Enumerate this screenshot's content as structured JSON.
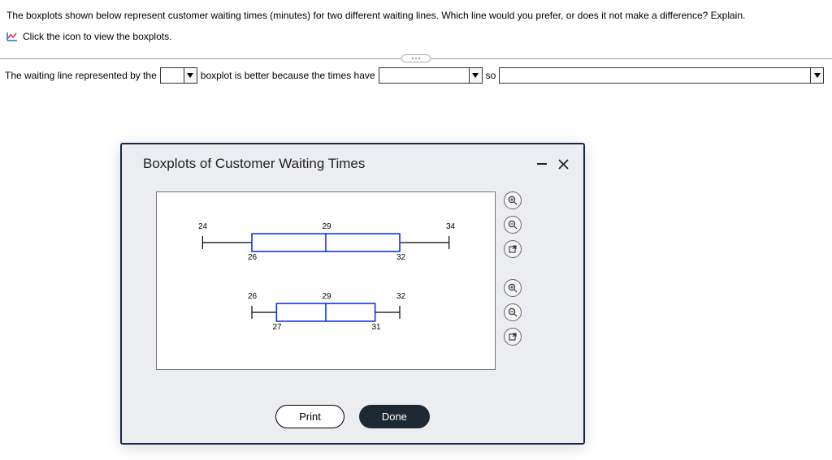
{
  "question": {
    "text": "The boxplots shown below represent customer waiting times (minutes) for two different waiting lines. Which line would you prefer, or does it not make a difference? Explain.",
    "view_link": "Click the icon to view the boxplots."
  },
  "sentence": {
    "part1": "The waiting line represented by the",
    "part2": "boxplot is better because the times have",
    "part3": "so"
  },
  "modal": {
    "title": "Boxplots of Customer Waiting Times",
    "print": "Print",
    "done": "Done"
  },
  "chart_data": [
    {
      "type": "boxplot",
      "name": "top",
      "min": 24,
      "q1": 26,
      "median": 29,
      "q3": 32,
      "max": 34,
      "xunit": "minutes",
      "xlim": [
        23,
        35
      ]
    },
    {
      "type": "boxplot",
      "name": "bottom",
      "min": 26,
      "q1": 27,
      "median": 29,
      "q3": 31,
      "max": 32,
      "xunit": "minutes",
      "xlim": [
        23,
        35
      ]
    }
  ]
}
